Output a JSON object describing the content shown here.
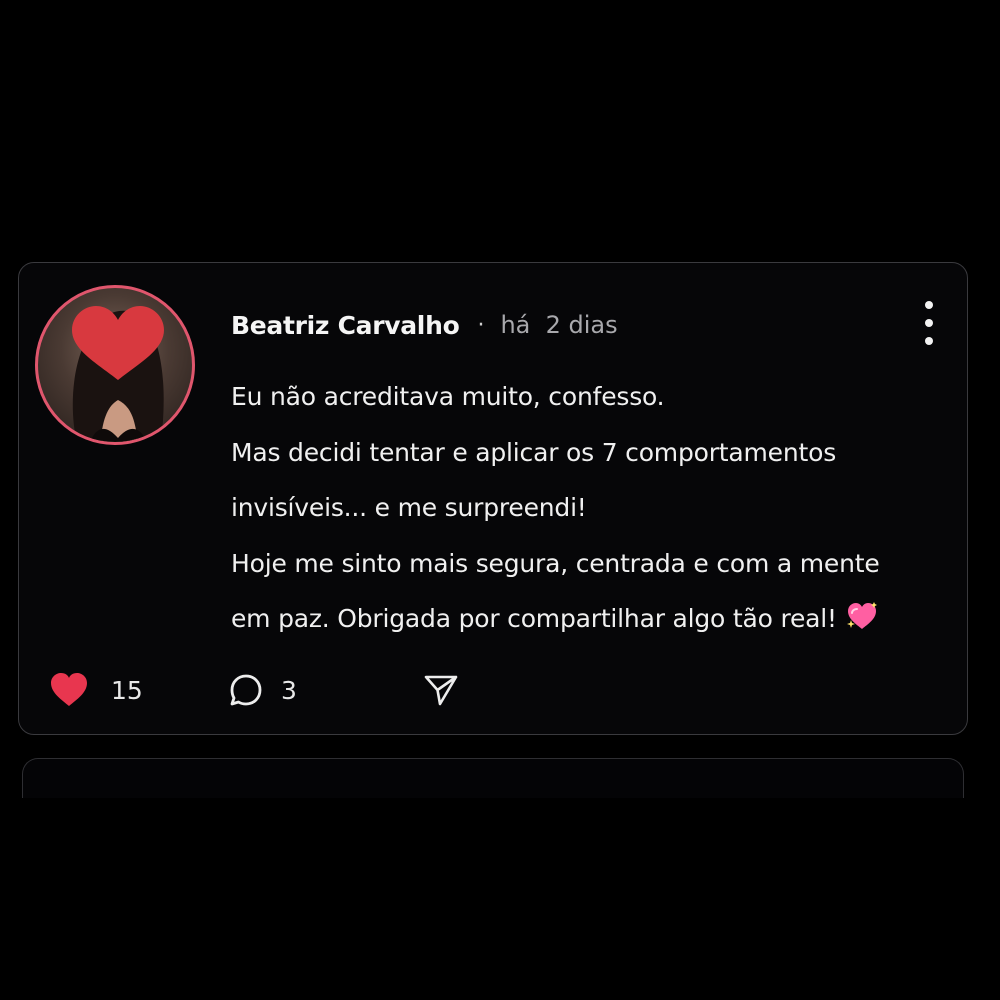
{
  "post": {
    "author": "Beatriz Carvalho",
    "separator": "·",
    "timestamp": "há  2 dias",
    "lines": [
      "Eu não acreditava muito, confesso.",
      "Mas decidi tentar e aplicar os 7 comportamentos",
      "invisíveis... e me surpreendi!",
      "Hoje me sinto mais segura, centrada e com a mente",
      "em paz. Obrigada por compartilhar algo tão real!"
    ],
    "emoji": "sparkling-heart",
    "likes": "15",
    "comments": "3"
  },
  "icons": {
    "avatar_cover": "heart-icon",
    "more": "more-vertical-icon",
    "like": "heart-icon",
    "comment": "comment-bubble-icon",
    "share": "send-icon"
  },
  "colors": {
    "background": "#000000",
    "card_border": "#3a3a3e",
    "like_red": "#e8364f",
    "avatar_ring": "#e0566d",
    "muted_text": "#a8a8ac"
  }
}
